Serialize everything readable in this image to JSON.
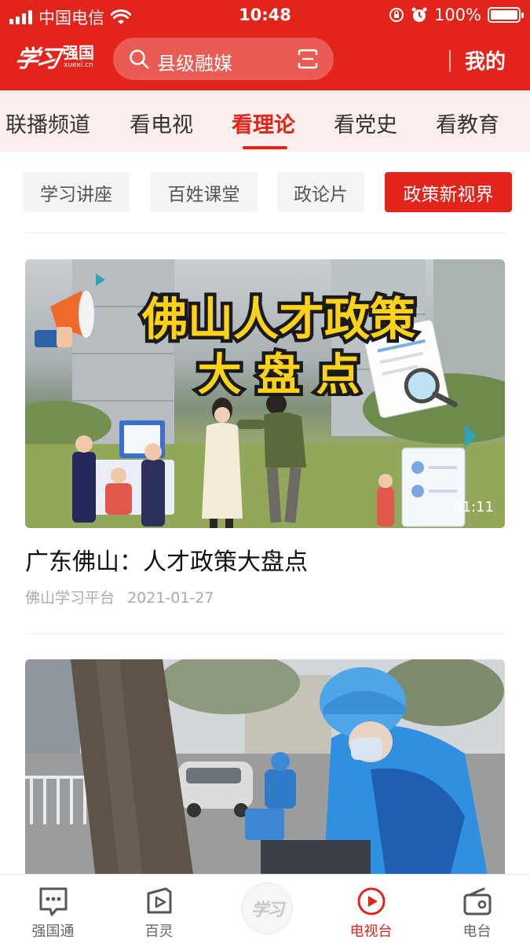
{
  "status_bar": {
    "carrier": "中国电信",
    "time": "10:48",
    "battery": "100%",
    "battery_level": 1.0
  },
  "header": {
    "logo_text": "强国",
    "logo_script": "学习",
    "logo_url": "xuexi.cn",
    "search_text": "县级融媒",
    "mine_label": "我的"
  },
  "channel_tabs": [
    "联播频道",
    "看电视",
    "看理论",
    "看党史",
    "看教育"
  ],
  "active_channel": "看理论",
  "sub_tabs": [
    "学习讲座",
    "百姓课堂",
    "政论片",
    "政策新视界"
  ],
  "active_sub_tab": "政策新视界",
  "cards": [
    {
      "thumbnail_text_line1": "佛山人才政策",
      "thumbnail_text_line2": "大 盘 点",
      "duration": "01:11",
      "title": "广东佛山：人才政策大盘点",
      "source": "佛山学习平台",
      "date": "2021-01-27"
    }
  ],
  "bottom_nav": [
    {
      "label": "强国通",
      "icon": "chat-icon"
    },
    {
      "label": "百灵",
      "icon": "video-play-icon"
    },
    {
      "label": "",
      "icon": "xuexi-logo-icon"
    },
    {
      "label": "电视台",
      "icon": "tv-play-icon"
    },
    {
      "label": "电台",
      "icon": "radio-icon"
    }
  ],
  "colors": {
    "brand_red": "#e3241b",
    "headline_yellow": "#ffd21a",
    "text_gray": "#aaaaaa"
  }
}
